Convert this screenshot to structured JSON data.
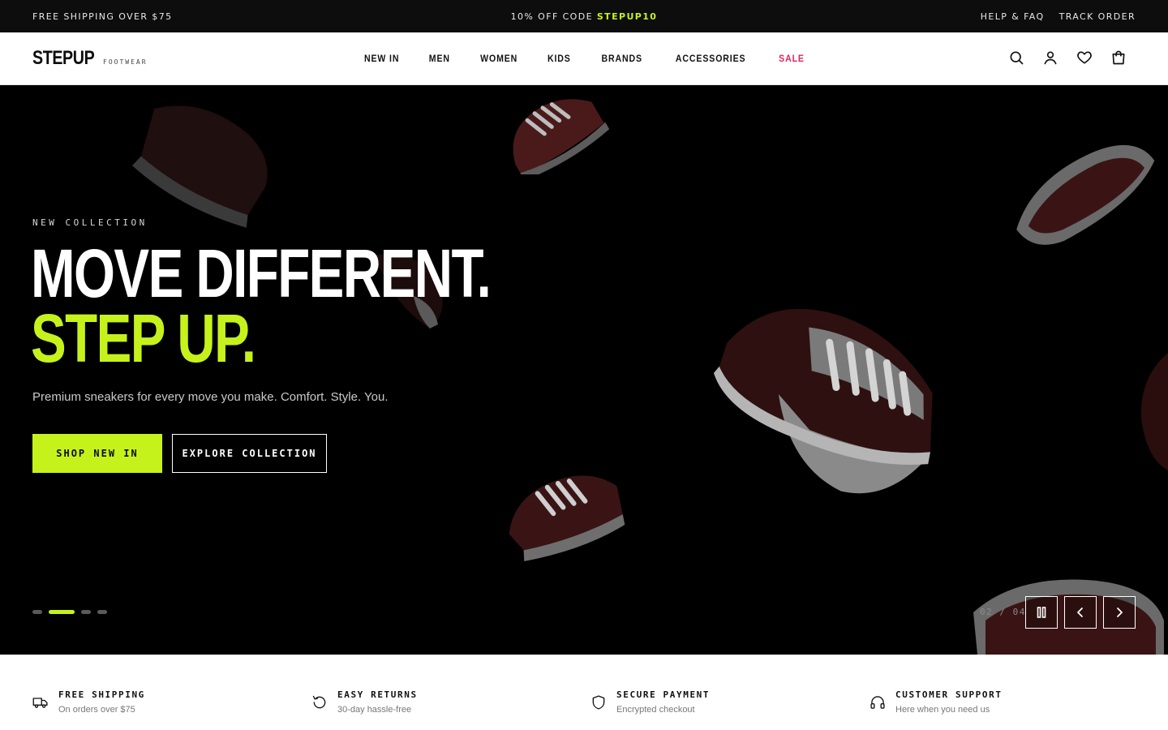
{
  "announcement": {
    "left": "FREE SHIPPING OVER $75",
    "center_prefix": "10% OFF CODE ",
    "center_code": "STEPUP10",
    "links": [
      "HELP & FAQ",
      "TRACK ORDER"
    ]
  },
  "header": {
    "logo_main": "STEPUP",
    "logo_sub": "FOOTWEAR",
    "nav": [
      "NEW IN",
      "MEN",
      "WOMEN",
      "KIDS",
      "BRANDS",
      "ACCESSORIES",
      "SALE"
    ],
    "icons": [
      "search-icon",
      "account-icon",
      "wishlist-icon",
      "cart-icon"
    ]
  },
  "hero": {
    "eyebrow": "NEW COLLECTION",
    "headline_line1": "MOVE DIFFERENT.",
    "headline_line2": "STEP UP.",
    "subtitle": "Premium sneakers for every move you make. Comfort. Style. You.",
    "primary_cta": "SHOP NEW IN",
    "secondary_cta": "EXPLORE COLLECTION",
    "slide_current": "02",
    "slide_separator": " / ",
    "slide_total": "04",
    "active_slide_index": 2,
    "slide_count": 4
  },
  "features": [
    {
      "icon": "truck-icon",
      "title": "FREE SHIPPING",
      "desc": "On orders over $75"
    },
    {
      "icon": "return-icon",
      "title": "EASY RETURNS",
      "desc": "30-day hassle-free"
    },
    {
      "icon": "shield-icon",
      "title": "SECURE PAYMENT",
      "desc": "Encrypted checkout"
    },
    {
      "icon": "headphones-icon",
      "title": "CUSTOMER SUPPORT",
      "desc": "Here when you need us"
    }
  ],
  "colors": {
    "accent": "#c6f21c",
    "sale": "#e0245e",
    "dark": "#0d0d0d"
  }
}
